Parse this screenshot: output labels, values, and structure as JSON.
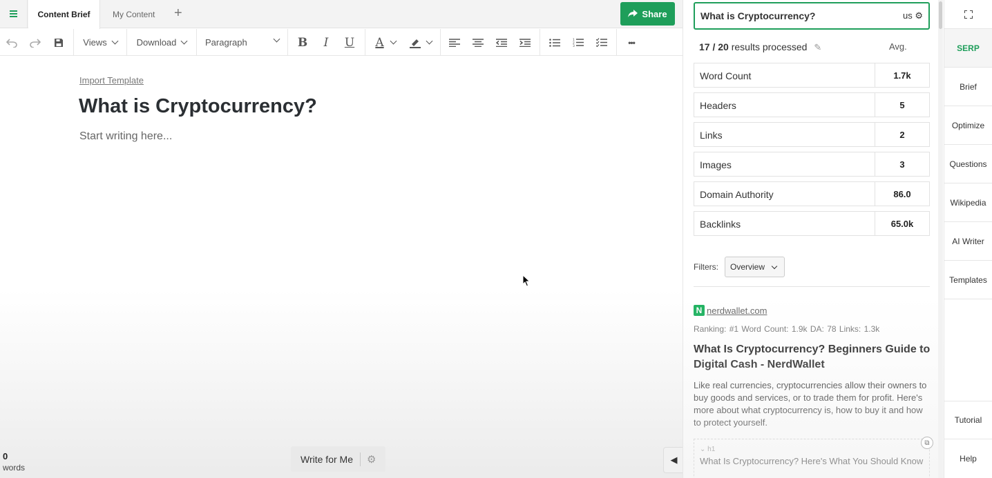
{
  "tabs": {
    "active": "Content Brief",
    "second": "My Content",
    "add": "+"
  },
  "share": {
    "label": "Share"
  },
  "toolbar": {
    "views": "Views",
    "download": "Download",
    "paragraph": "Paragraph",
    "bold": "B",
    "italic": "I",
    "underline": "U",
    "text_color": "A",
    "more": "•••"
  },
  "editor": {
    "import_template": "Import Template",
    "title": "What is Cryptocurrency?",
    "placeholder": "Start writing here...",
    "word_count": "0",
    "word_label": "words",
    "write_for_me": "Write for Me"
  },
  "panel": {
    "keyword": "What is Cryptocurrency?",
    "location": "us",
    "processed_count": "17 / 20",
    "processed_label": "results processed",
    "avg_label": "Avg.",
    "metrics": [
      {
        "name": "Word Count",
        "value": "1.7k"
      },
      {
        "name": "Headers",
        "value": "5"
      },
      {
        "name": "Links",
        "value": "2"
      },
      {
        "name": "Images",
        "value": "3"
      },
      {
        "name": "Domain Authority",
        "value": "86.0"
      },
      {
        "name": "Backlinks",
        "value": "65.0k"
      }
    ],
    "filters_label": "Filters:",
    "filters_value": "Overview",
    "result": {
      "favicon": "N",
      "domain": "nerdwallet.com",
      "stats": "Ranking: #1  Word Count: 1.9k  DA: 78  Links: 1.3k",
      "title": "What Is Cryptocurrency? Beginners Guide to Digital Cash - NerdWallet",
      "description": "Like real currencies, cryptocurrencies allow their owners to buy goods and services, or to trade them for profit. Here's more about what cryptocurrency is, how to buy it and how to protect yourself.",
      "heading_tag": "h1",
      "heading_text": "What Is Cryptocurrency? Here's What You Should Know"
    }
  },
  "sidenav": {
    "items": [
      "SERP",
      "Brief",
      "Optimize",
      "Questions",
      "Wikipedia",
      "AI Writer",
      "Templates"
    ],
    "tutorial": "Tutorial",
    "help": "Help"
  },
  "colors": {
    "accent": "#1e9e5a"
  }
}
